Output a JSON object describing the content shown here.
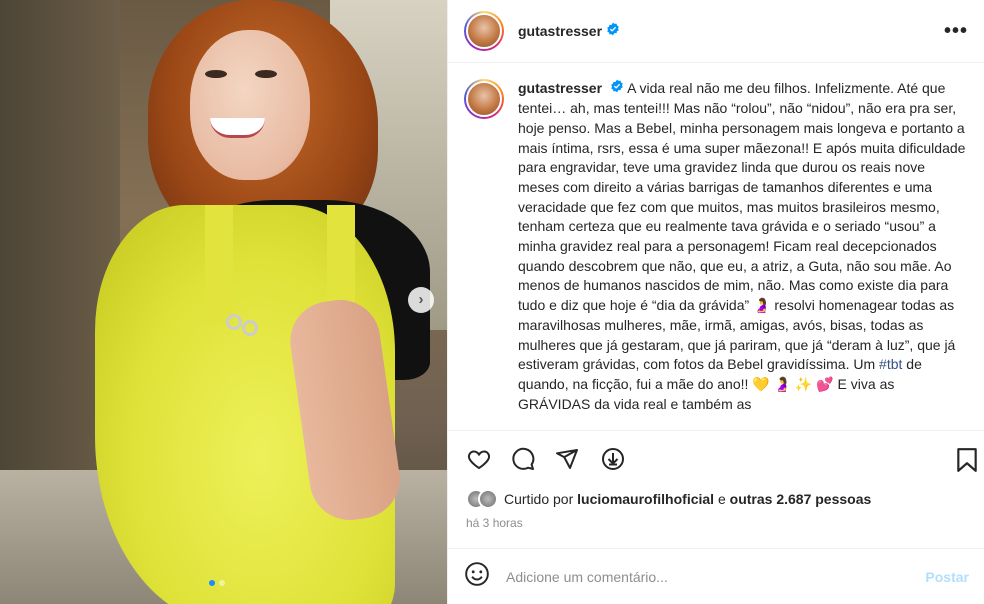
{
  "post": {
    "username": "gutastresser",
    "caption_text": "A vida real não me deu filhos. Infelizmente. Até que tentei… ah, mas tentei!!! Mas não “rolou”, não “nidou”, não era pra ser, hoje penso. Mas a Bebel, minha personagem mais longeva e portanto a mais íntima, rsrs, essa é uma super mãezona!! E após muita dificuldade para engravidar, teve uma gravidez linda que durou os reais nove meses com direito a várias barrigas de tamanhos diferentes e uma veracidade que fez com que muitos, mas muitos brasileiros mesmo, tenham certeza que eu realmente tava grávida e o seriado “usou” a minha gravidez real para a personagem! Ficam real decepcionados quando descobrem que não, que eu, a atriz, a Guta, não sou mãe. Ao menos de humanos nascidos de mim, não. Mas como existe dia para tudo e diz que hoje é “dia da grávida” 🤰 resolvi homenagear todas as maravilhosas mulheres, mãe, irmã, amigas, avós, bisas, todas as mulheres que já gestaram, que já pariram, que já “deram à luz”, que já estiveram grávidas, com fotos da Bebel gravidíssima. Um",
    "hashtag": "#tbt",
    "caption_after": " de quando, na ficção, fui a mãe do ano!! 💛 🤰 ✨ 💕 E viva as GRÁVIDAS da vida real e também as",
    "liked_prefix": "Curtido por ",
    "liked_user": "luciomaurofilhoficial",
    "liked_mid": " e ",
    "liked_others": "outras 2.687 pessoas",
    "time": "há 3 horas"
  },
  "comment": {
    "placeholder": "Adicione um comentário...",
    "post_label": "Postar"
  },
  "colors": {
    "verified": "#0095f6",
    "hashtag": "#385185",
    "post_disabled": "#b2dffc"
  },
  "icons": {
    "more": "more-options-icon",
    "like": "heart-icon",
    "comment": "comment-icon",
    "share": "share-icon",
    "save": "bookmark-icon",
    "extra": "download-circle-icon",
    "emoji": "emoji-icon",
    "next": "chevron-right-icon"
  },
  "carousel": {
    "current": 1,
    "total": 2
  },
  "ui_text": {
    "more_dots": "•••",
    "next_arrow": "›"
  }
}
